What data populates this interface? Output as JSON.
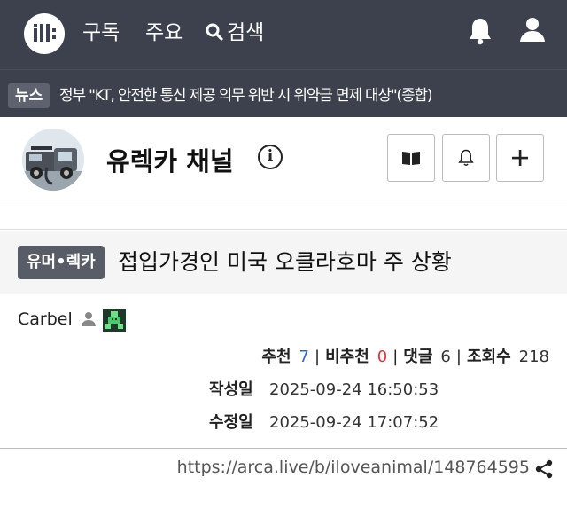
{
  "nav": {
    "logo_icon": "arca-logo-icon",
    "subscribe_label": "구독",
    "main_label": "주요",
    "search_label": "검색",
    "search_icon": "search-icon",
    "notification_icon": "bell-icon",
    "user_icon": "user-icon"
  },
  "news": {
    "badge": "뉴스",
    "headline": "정부 \"KT, 안전한 통신 제공 의무 위반 시 위약금 면제 대상\"(종합)"
  },
  "channel": {
    "name": "유렉카 채널",
    "info_label": "i",
    "buttons": {
      "bookmark_icon": "book-icon",
      "subscribe_icon": "bell-icon",
      "add_icon": "plus-icon"
    }
  },
  "post": {
    "category": "유머•렉카",
    "title": "접입가경인 미국 오클라호마 주 상황",
    "author": "Carbel",
    "stats": {
      "recommend_label": "추천",
      "recommend_value": "7",
      "unrecommend_label": "비추천",
      "unrecommend_value": "0",
      "comments_label": "댓글",
      "comments_value": "6",
      "views_label": "조회수",
      "views_value": "218"
    },
    "created_label": "작성일",
    "created_value": "2025-09-24 16:50:53",
    "modified_label": "수정일",
    "modified_value": "2025-09-24 17:07:52",
    "url": "https://arca.live/b/iloveanimal/148764595"
  },
  "colors": {
    "nav_bg": "#3d414d",
    "recommend": "#3366cc",
    "unrecommend": "#dd3333"
  }
}
